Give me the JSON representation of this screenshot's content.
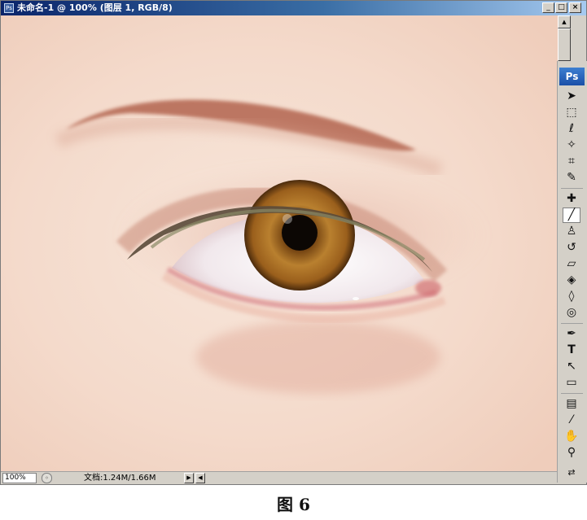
{
  "window": {
    "title": "未命名-1 @ 100% (图层 1, RGB/8)",
    "buttons": {
      "minimize": "_",
      "maximize": "□",
      "close": "×"
    }
  },
  "canvas": {
    "content": "painted human eye with eyebrow",
    "iris_color": "#9a5f1c",
    "skin_color": "#f3dccd"
  },
  "statusbar": {
    "zoom": "100%",
    "doc_info": "文档:1.24M/1.66M"
  },
  "toolbox": {
    "logo": "Ps",
    "tools": [
      {
        "name": "move-tool",
        "glyph": "➤"
      },
      {
        "name": "marquee-tool",
        "glyph": "⬚"
      },
      {
        "name": "lasso-tool",
        "glyph": "ℓ"
      },
      {
        "name": "magic-wand-tool",
        "glyph": "✧"
      },
      {
        "name": "crop-tool",
        "glyph": "⌗"
      },
      {
        "name": "slice-tool",
        "glyph": "✎"
      },
      {
        "name": "healing-brush-tool",
        "glyph": "✚"
      },
      {
        "name": "brush-tool",
        "glyph": "╱"
      },
      {
        "name": "clone-stamp-tool",
        "glyph": "♙"
      },
      {
        "name": "history-brush-tool",
        "glyph": "↺"
      },
      {
        "name": "eraser-tool",
        "glyph": "▱"
      },
      {
        "name": "paint-bucket-tool",
        "glyph": "◈"
      },
      {
        "name": "blur-tool",
        "glyph": "◊"
      },
      {
        "name": "dodge-tool",
        "glyph": "◎"
      },
      {
        "name": "pen-tool",
        "glyph": "✒"
      },
      {
        "name": "type-tool",
        "glyph": "T"
      },
      {
        "name": "path-selection-tool",
        "glyph": "↖"
      },
      {
        "name": "shape-tool",
        "glyph": "▭"
      },
      {
        "name": "notes-tool",
        "glyph": "▤"
      },
      {
        "name": "eyedropper-tool",
        "glyph": "⁄"
      },
      {
        "name": "hand-tool",
        "glyph": "✋"
      },
      {
        "name": "zoom-tool",
        "glyph": "⚲"
      }
    ],
    "color_swap": "⇄"
  },
  "caption": "图 6"
}
